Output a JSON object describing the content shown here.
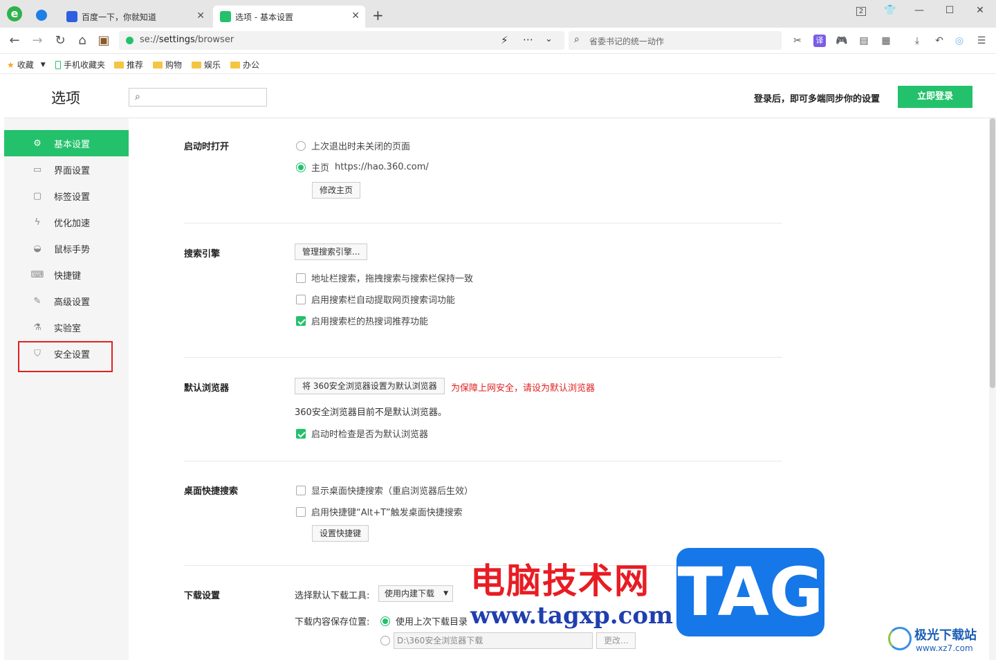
{
  "tabs": [
    {
      "title": "百度一下，你就知道",
      "active": false
    },
    {
      "title": "选项 - 基本设置",
      "active": true
    }
  ],
  "tabbar": {
    "new_tab": "+",
    "tab_count": "2"
  },
  "address": {
    "url_scheme": "se://",
    "url_path": "settings",
    "url_rest": "/browser",
    "search_text": "省委书记的统一动作"
  },
  "bookmarks": [
    "收藏",
    "手机收藏夹",
    "推荐",
    "购物",
    "娱乐",
    "办公"
  ],
  "header": {
    "title": "选项",
    "sync_text": "登录后，即可多端同步你的设置",
    "login_label": "立即登录"
  },
  "sidebar": {
    "items": [
      {
        "label": "基本设置",
        "icon": "gear-icon",
        "active": true
      },
      {
        "label": "界面设置",
        "icon": "layout-icon"
      },
      {
        "label": "标签设置",
        "icon": "tab-icon"
      },
      {
        "label": "优化加速",
        "icon": "lightning-icon"
      },
      {
        "label": "鼠标手势",
        "icon": "mouse-icon"
      },
      {
        "label": "快捷键",
        "icon": "keyboard-icon"
      },
      {
        "label": "高级设置",
        "icon": "wrench-icon"
      },
      {
        "label": "实验室",
        "icon": "flask-icon"
      },
      {
        "label": "安全设置",
        "icon": "shield-icon"
      }
    ]
  },
  "startup": {
    "title": "启动时打开",
    "opt_last": "上次退出时未关闭的页面",
    "opt_home": "主页",
    "home_url": "https://hao.360.com/",
    "modify_btn": "修改主页"
  },
  "search_engine": {
    "title": "搜索引擎",
    "manage_btn": "管理搜索引擎...",
    "opt1": "地址栏搜索，拖拽搜索与搜索栏保持一致",
    "opt2": "启用搜索栏自动提取网页搜索词功能",
    "opt3": "启用搜索栏的热搜词推荐功能"
  },
  "default_browser": {
    "title": "默认浏览器",
    "set_btn": "将 360安全浏览器设置为默认浏览器",
    "warning": "为保障上网安全，请设为默认浏览器",
    "status": "360安全浏览器目前不是默认浏览器。",
    "opt_check": "启动时检查是否为默认浏览器",
    "warning_color": "#e02020"
  },
  "desktop_search": {
    "title": "桌面快捷搜索",
    "opt1": "显示桌面快捷搜索（重启浏览器后生效）",
    "opt2": "启用快捷键“Alt+T”触发桌面快捷搜索",
    "set_btn": "设置快捷键"
  },
  "download": {
    "title": "下载设置",
    "tool_label": "选择默认下载工具:",
    "tool_value": "使用内建下载",
    "location_label": "下载内容保存位置:",
    "opt_last_dir": "使用上次下载目录",
    "path_value": "D:\\360安全浏览器下载",
    "change_btn": "更改..."
  },
  "watermark": {
    "cn": "电脑技术网",
    "url": "www.tagxp.com",
    "tag": "TAG",
    "brand": "极光下载站",
    "brand_url": "www.xz7.com"
  },
  "colors": {
    "accent": "#23c16b",
    "highlight_box": "#e02020"
  }
}
